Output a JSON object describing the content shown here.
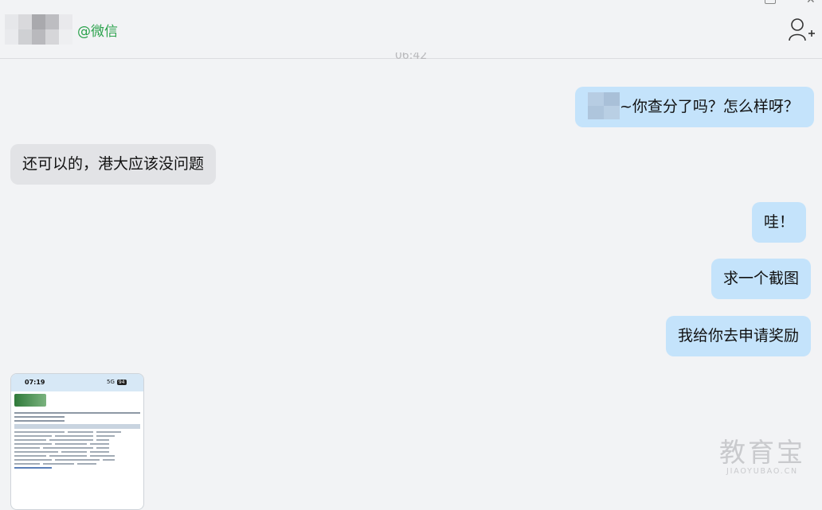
{
  "header": {
    "contact_name": "@微信",
    "add_friend_icon": "add-user-icon"
  },
  "timestamp": "06:42",
  "messages": [
    {
      "direction": "out",
      "text": "~你查分了吗？怎么样呀？"
    },
    {
      "direction": "in",
      "text": "还可以的，港大应该没问题"
    },
    {
      "direction": "out",
      "text": "哇！"
    },
    {
      "direction": "out",
      "text": "求一个截图"
    },
    {
      "direction": "out",
      "text": "我给你去申请奖励"
    }
  ],
  "image_message": {
    "status_time": "07:19",
    "status_network": "5G",
    "status_battery": "94"
  },
  "watermark": {
    "main": "教育宝",
    "sub": "JIAOYUBAO.CN"
  },
  "colors": {
    "outgoing_bubble": "#c4e3fb",
    "incoming_bubble": "#e2e3e6",
    "contact_name": "#2ba24c",
    "background": "#f2f3f5"
  }
}
